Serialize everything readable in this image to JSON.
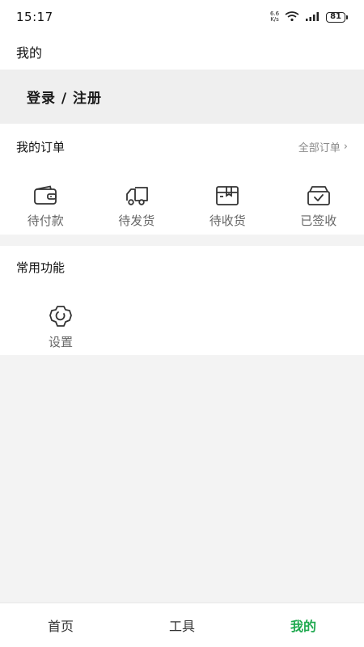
{
  "status_bar": {
    "time": "15:17",
    "net_speed_value": "6.6",
    "net_speed_unit": "K/s",
    "battery": "81"
  },
  "header": {
    "title": "我的"
  },
  "login": {
    "label": "登录 / 注册"
  },
  "orders": {
    "title": "我的订单",
    "all_orders_label": "全部订单",
    "items": [
      {
        "label": "待付款",
        "icon": "wallet-icon"
      },
      {
        "label": "待发货",
        "icon": "truck-icon"
      },
      {
        "label": "待收货",
        "icon": "package-icon"
      },
      {
        "label": "已签收",
        "icon": "signed-box-icon"
      }
    ]
  },
  "functions": {
    "title": "常用功能",
    "items": [
      {
        "label": "设置",
        "icon": "gear-icon"
      }
    ]
  },
  "bottom_nav": {
    "items": [
      {
        "label": "首页"
      },
      {
        "label": "工具"
      },
      {
        "label": "我的"
      }
    ],
    "active_color": "#1fa94f"
  }
}
